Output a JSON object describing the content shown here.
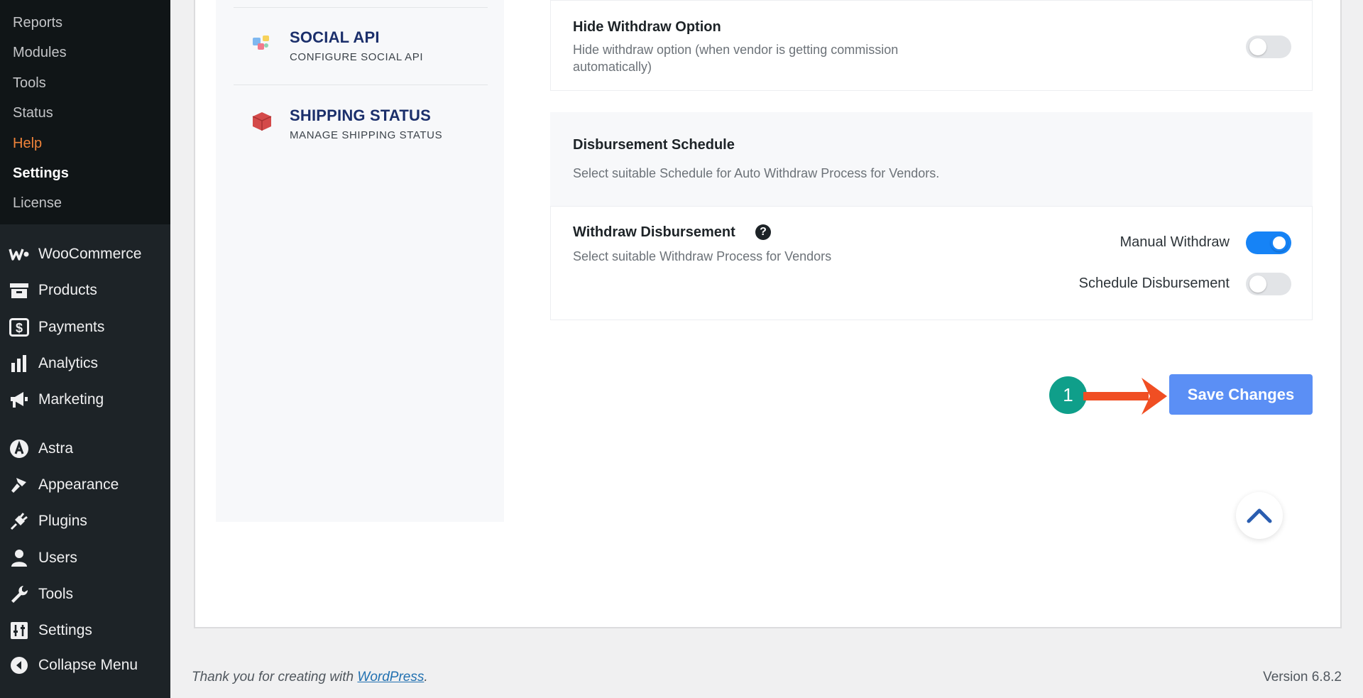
{
  "sidebar": {
    "submenu": [
      "Reports",
      "Modules",
      "Tools",
      "Status",
      "Help",
      "Settings",
      "License"
    ],
    "menu": [
      {
        "label": "WooCommerce",
        "icon": "woocommerce-icon"
      },
      {
        "label": "Products",
        "icon": "archive-box-icon"
      },
      {
        "label": "Payments",
        "icon": "dollar-icon"
      },
      {
        "label": "Analytics",
        "icon": "bar-chart-icon"
      },
      {
        "label": "Marketing",
        "icon": "megaphone-icon"
      },
      {
        "label": "Astra",
        "icon": "astra-icon"
      },
      {
        "label": "Appearance",
        "icon": "paintbrush-icon"
      },
      {
        "label": "Plugins",
        "icon": "plug-icon"
      },
      {
        "label": "Users",
        "icon": "user-icon"
      },
      {
        "label": "Tools",
        "icon": "wrench-icon"
      },
      {
        "label": "Settings",
        "icon": "sliders-icon"
      },
      {
        "label": "Collapse Menu",
        "icon": "collapse-arrow-icon"
      }
    ]
  },
  "settings_nav": [
    {
      "title": "SOCIAL API",
      "subtitle": "CONFIGURE SOCIAL API",
      "icon": "social-api-icon"
    },
    {
      "title": "SHIPPING STATUS",
      "subtitle": "MANAGE SHIPPING STATUS",
      "icon": "shipping-box-icon"
    }
  ],
  "hide_withdraw": {
    "title": "Hide Withdraw Option",
    "desc_line1": "Hide withdraw option (when vendor is getting commission",
    "desc_line2": "automatically)",
    "enabled": false
  },
  "disbursement_schedule": {
    "title": "Disbursement Schedule",
    "desc": "Select suitable Schedule for Auto Withdraw Process for Vendors."
  },
  "withdraw_disbursement": {
    "title": "Withdraw Disbursement",
    "help": "?",
    "desc": "Select suitable Withdraw Process for Vendors",
    "options": [
      {
        "label": "Manual Withdraw",
        "enabled": true
      },
      {
        "label": "Schedule Disbursement",
        "enabled": false
      }
    ]
  },
  "save_button": "Save Changes",
  "step_badge": "1",
  "footer": {
    "text": "Thank you for creating with ",
    "link": "WordPress",
    "period": ".",
    "version": "Version 6.8.2"
  },
  "colors": {
    "accent": "#1683f6",
    "save_button": "#5b8ff5",
    "arrow": "#f04e23",
    "badge": "#0f9f8a",
    "help": "#f0833a"
  }
}
